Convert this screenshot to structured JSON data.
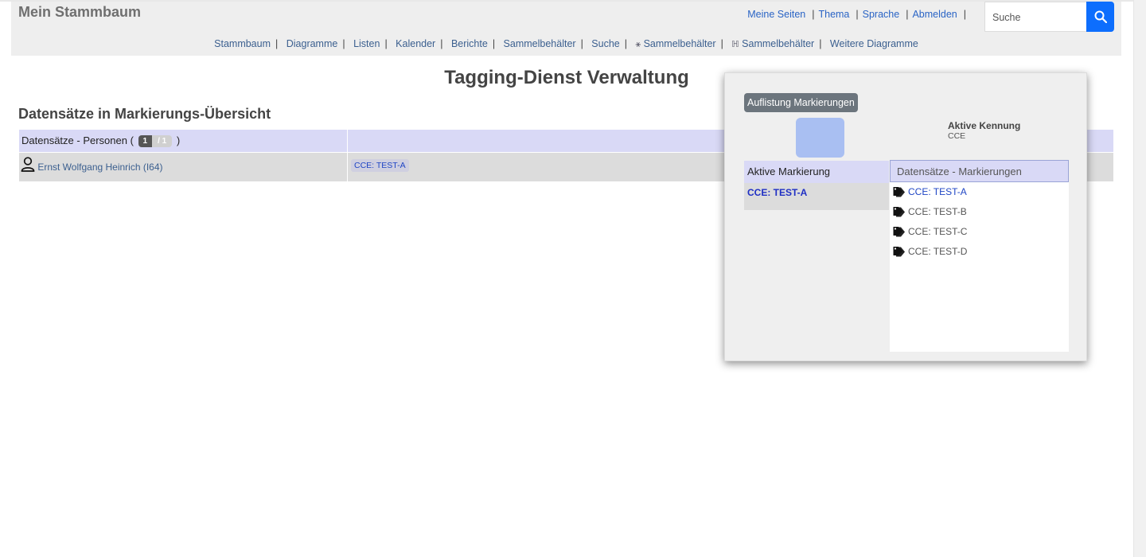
{
  "header": {
    "site_title": "Mein Stammbaum",
    "top_links": [
      {
        "label": "Meine Seiten"
      },
      {
        "label": "Thema"
      },
      {
        "label": "Sprache"
      },
      {
        "label": "Abmelden"
      }
    ],
    "search": {
      "placeholder": "Suche"
    },
    "main_nav": [
      {
        "label": "Stammbaum"
      },
      {
        "label": "Diagramme"
      },
      {
        "label": "Listen"
      },
      {
        "label": "Kalender"
      },
      {
        "label": "Berichte"
      },
      {
        "label": "Sammelbehälter"
      },
      {
        "label": "Suche"
      },
      {
        "label": "Sammelbehälter",
        "glyph": "⚹"
      },
      {
        "label": "Sammelbehälter",
        "glyph": "ℍ"
      },
      {
        "label": "Weitere Diagramme"
      }
    ]
  },
  "main": {
    "page_title": "Tagging-Dienst Verwaltung",
    "section_title": "Datensätze in Markierungs-Übersicht",
    "persons": {
      "label_prefix": "Datensätze - Personen (",
      "label_suffix": ")",
      "count": "1",
      "total": "/ 1",
      "rows": [
        {
          "name": "Ernst Wolfgang Heinrich (I64)",
          "tag": "CCE: TEST-A"
        }
      ]
    }
  },
  "popup": {
    "list_button": "Auflistung Markierungen",
    "active_id_label": "Aktive Kennung",
    "active_id_value": "CCE",
    "active_tag_header": "Aktive Markierung",
    "active_tag_value": "CCE: TEST-A",
    "records_header": "Datensätze - Markierungen",
    "tags": [
      {
        "label": "CCE: TEST-A",
        "active": true
      },
      {
        "label": "CCE: TEST-B",
        "active": false
      },
      {
        "label": "CCE: TEST-C",
        "active": false
      },
      {
        "label": "CCE: TEST-D",
        "active": false
      }
    ],
    "colors": {
      "swatch": "#a9bff2"
    }
  }
}
